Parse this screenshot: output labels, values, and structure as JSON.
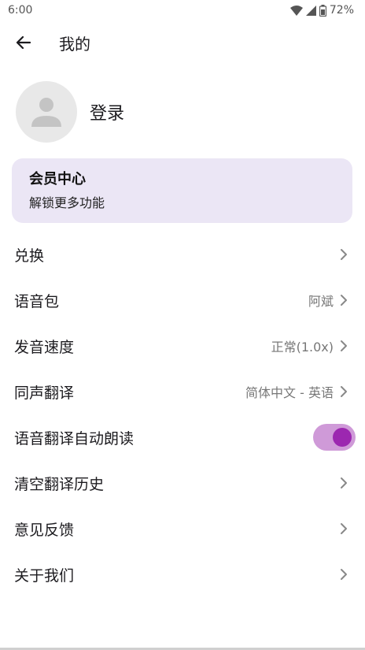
{
  "status_bar": {
    "time": "6:00",
    "battery": "72%",
    "icons": [
      "wifi-icon",
      "signal-icon",
      "battery-icon"
    ]
  },
  "app_bar": {
    "title": "我的",
    "back_icon": "arrow-left-icon"
  },
  "profile": {
    "login_label": "登录",
    "avatar_icon": "person-icon"
  },
  "member_card": {
    "title": "会员中心",
    "subtitle": "解锁更多功能",
    "background": "#ebe6f5"
  },
  "menu": {
    "items": [
      {
        "label": "兑换",
        "value": ""
      },
      {
        "label": "语音包",
        "value": "阿斌"
      },
      {
        "label": "发音速度",
        "value": "正常(1.0x)"
      },
      {
        "label": "同声翻译",
        "value": "简体中文 - 英语"
      },
      {
        "label": "语音翻译自动朗读",
        "value": "",
        "toggle_on": true
      },
      {
        "label": "清空翻译历史",
        "value": ""
      },
      {
        "label": "意见反馈",
        "value": ""
      },
      {
        "label": "关于我们",
        "value": ""
      }
    ]
  },
  "colors": {
    "accent": "#9c27b0",
    "switch_track": "#cf9ad8",
    "secondary_text": "#777777"
  }
}
